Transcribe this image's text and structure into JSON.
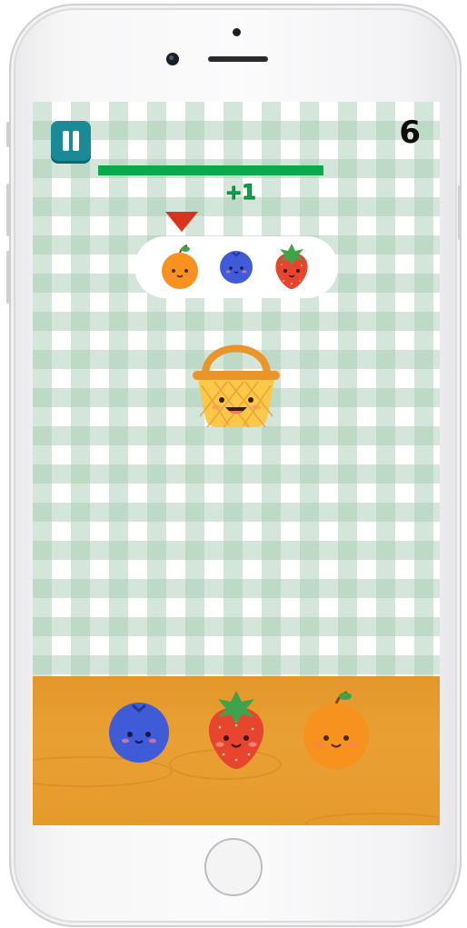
{
  "hud": {
    "score": "6",
    "bonus": "+1",
    "time_remaining_fraction": 0.62
  },
  "order": {
    "items": [
      "orange",
      "blueberry",
      "strawberry"
    ],
    "current_index": 0
  },
  "basket": {
    "icon": "basket-icon"
  },
  "fruit_choices": [
    {
      "kind": "blueberry",
      "icon": "blueberry-icon"
    },
    {
      "kind": "strawberry",
      "icon": "strawberry-icon"
    },
    {
      "kind": "orange",
      "icon": "orange-icon"
    }
  ],
  "colors": {
    "pause_button": "#1a8a97",
    "timer_bar": "#0aaa4c",
    "table": "#e79a2c",
    "orange": "#f7921e",
    "blueberry": "#3f5bd8",
    "strawberry": "#e8452f"
  }
}
